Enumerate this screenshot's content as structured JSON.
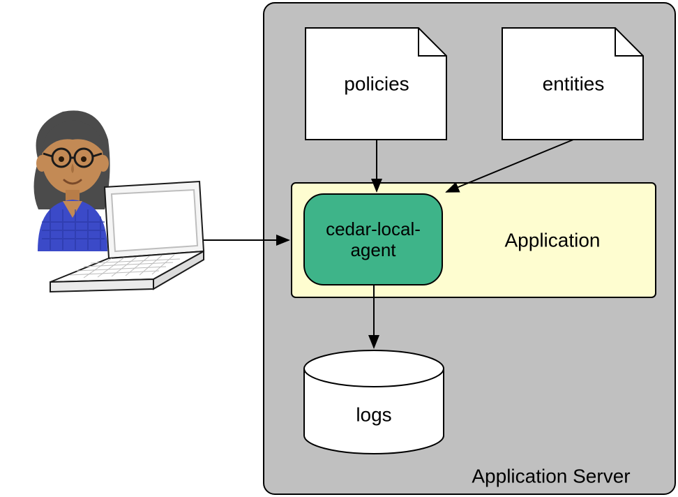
{
  "boxes": {
    "policies": "policies",
    "entities": "entities",
    "agent_line1": "cedar-local-",
    "agent_line2": "agent",
    "application": "Application",
    "logs": "logs",
    "server": "Application Server"
  },
  "colors": {
    "server_bg": "#c0c0c0",
    "app_bg": "#fefdd0",
    "agent_bg": "#3eb489",
    "doc_bg": "#ffffff",
    "cyl_bg": "#ffffff",
    "skin": "#c38a55",
    "hair": "#4b4b4b",
    "shirt": "#3b4ac8",
    "laptop": "#f2f2f2"
  }
}
